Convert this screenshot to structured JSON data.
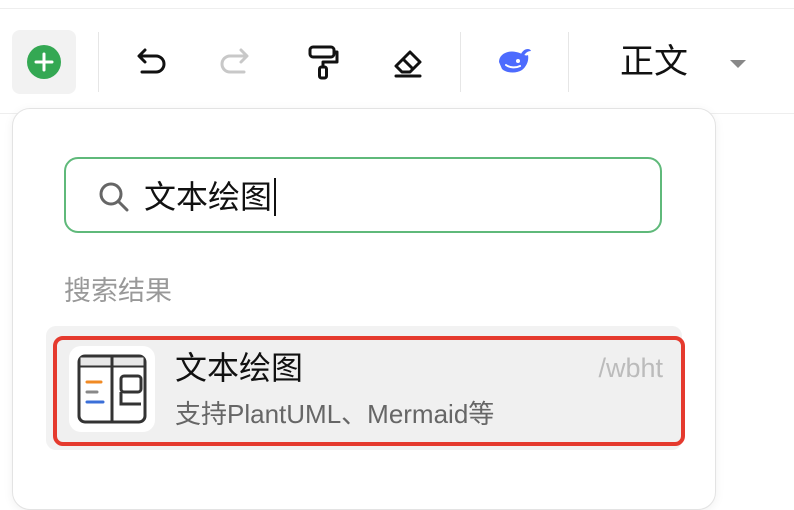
{
  "toolbar": {
    "style_dropdown_label": "正文"
  },
  "insert_panel": {
    "search": {
      "value": "文本绘图",
      "placeholder": ""
    },
    "section_label": "搜索结果",
    "results": [
      {
        "title": "文本绘图",
        "subtitle": "支持PlantUML、Mermaid等",
        "shortcut": "/wbht",
        "icon": "text-diagram-icon",
        "highlighted": true
      }
    ]
  },
  "colors": {
    "accent_green": "#34a853",
    "search_border": "#5fb97a",
    "highlight_red": "#e53a2e",
    "ai_blue": "#4d6bfe"
  },
  "icons": [
    "plus-icon",
    "undo-icon",
    "redo-icon",
    "format-painter-icon",
    "eraser-icon",
    "ai-whale-icon",
    "chevron-down-icon",
    "search-icon",
    "text-diagram-icon"
  ]
}
